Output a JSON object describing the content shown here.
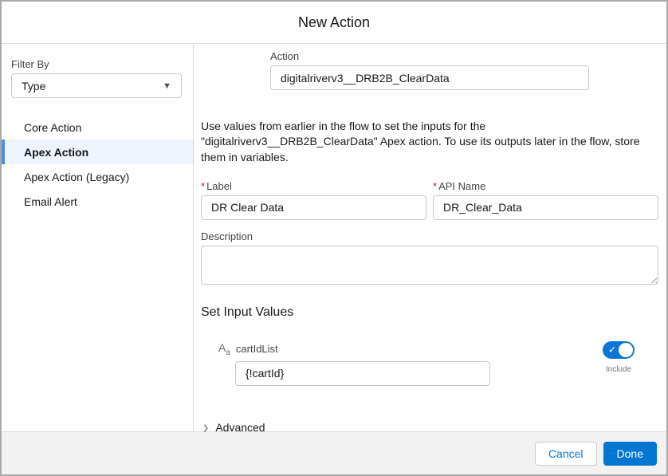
{
  "modal": {
    "title": "New Action"
  },
  "sidebar": {
    "filter_label": "Filter By",
    "filter_value": "Type",
    "items": [
      {
        "label": "Core Action",
        "selected": false
      },
      {
        "label": "Apex Action",
        "selected": true
      },
      {
        "label": "Apex Action (Legacy)",
        "selected": false
      },
      {
        "label": "Email Alert",
        "selected": false
      }
    ]
  },
  "main": {
    "action_field": {
      "label": "Action",
      "value": "digitalriverv3__DRB2B_ClearData"
    },
    "intro_text": "Use values from earlier in the flow to set the inputs for the \"digitalriverv3__DRB2B_ClearData\" Apex action. To use its outputs later in the flow, store them in variables.",
    "required_marker": "*",
    "label_field": {
      "label": "Label",
      "value": "DR Clear Data"
    },
    "api_name_field": {
      "label": "API Name",
      "value": "DR_Clear_Data"
    },
    "description_field": {
      "label": "Description",
      "value": ""
    },
    "section_heading": "Set Input Values",
    "param": {
      "icon": "text-type-icon",
      "icon_glyph_major": "A",
      "icon_glyph_minor": "a",
      "name": "cartIdList",
      "value": "{!cartId}",
      "toggle_label": "Include",
      "toggle_on": true
    },
    "advanced_label": "Advanced"
  },
  "footer": {
    "cancel_label": "Cancel",
    "done_label": "Done"
  },
  "icons": {
    "chevron_down": "▼",
    "chevron_right": "›",
    "checkmark": "✓"
  },
  "colors": {
    "brand": "#0176d3",
    "toggle_on": "#0b76d6",
    "selected_item_bg": "#eef4fe",
    "selected_item_border": "#4e8ee3",
    "required": "#ea001e"
  }
}
